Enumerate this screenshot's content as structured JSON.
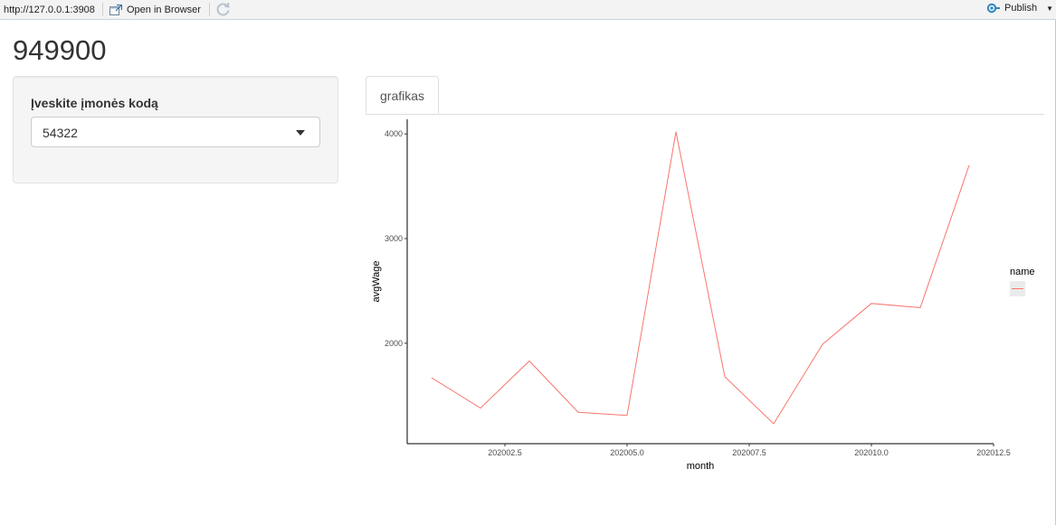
{
  "toolbar": {
    "url": "http://127.0.0.1:3908",
    "open_in_browser": "Open in Browser",
    "publish": "Publish"
  },
  "page": {
    "title": "949900"
  },
  "sidebar": {
    "input_label": "Įveskite įmonės kodą",
    "selected": "54322"
  },
  "tabs": [
    {
      "label": "grafikas",
      "active": true
    }
  ],
  "colors": {
    "line": "#f8766d",
    "accent": "#2e86c1"
  },
  "chart_data": {
    "type": "line",
    "xlabel": "month",
    "ylabel": "avgWage",
    "x_ticks": [
      202002.5,
      202005.0,
      202007.5,
      202010.0,
      202012.5
    ],
    "x_tick_labels": [
      "202002.5",
      "202005.0",
      "202007.5",
      "202010.0",
      "202012.5"
    ],
    "y_ticks": [
      2000,
      3000,
      4000
    ],
    "y_tick_labels": [
      "2000",
      "3000",
      "4000"
    ],
    "xlim": [
      202000.5,
      202012.5
    ],
    "ylim": [
      1040,
      4140
    ],
    "legend": {
      "title": "name",
      "position": "right"
    },
    "series": [
      {
        "x": [
          202001,
          202002,
          202003,
          202004,
          202005,
          202006,
          202007,
          202008,
          202009,
          202010,
          202011,
          202012
        ],
        "values": [
          1670,
          1380,
          1830,
          1340,
          1310,
          4020,
          1680,
          1230,
          1990,
          2380,
          2340,
          3700
        ]
      }
    ]
  }
}
